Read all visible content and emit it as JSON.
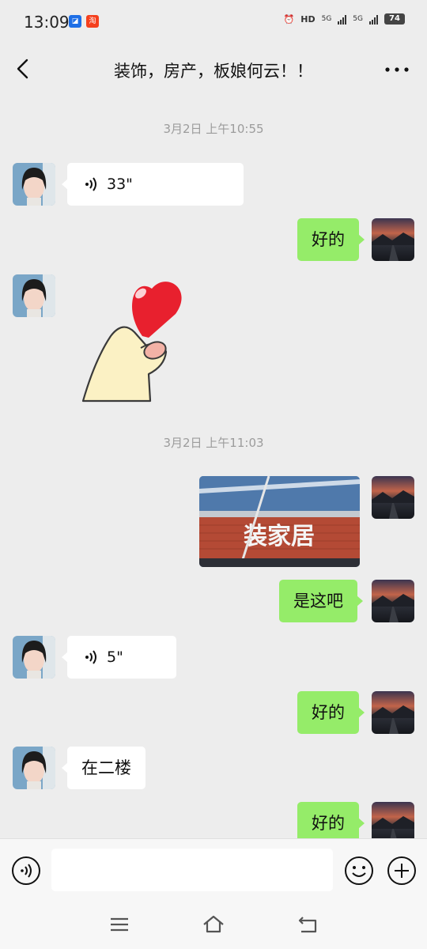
{
  "status_bar": {
    "time": "13:09",
    "app_icons": [
      "jd-app-icon",
      "taobao-app-icon"
    ],
    "taobao_label": "淘",
    "hd_label": "HD",
    "net1": "5G",
    "net2": "5G",
    "battery": "74"
  },
  "header": {
    "title": "装饰，房产，板娘何云！！"
  },
  "messages": {
    "ts1": "3月2日 上午10:55",
    "voice1_len": "33\"",
    "reply1": "好的",
    "ts2": "3月2日 上午11:03",
    "photo_signboard": "装家居",
    "reply2": "是这吧",
    "voice2_len": "5\"",
    "reply3": "好的",
    "text_in": "在二楼",
    "reply4": "好的"
  },
  "input": {
    "placeholder": ""
  },
  "colors": {
    "sent_bubble": "#95ec69",
    "received_bubble": "#ffffff",
    "chat_background": "#ededed"
  }
}
